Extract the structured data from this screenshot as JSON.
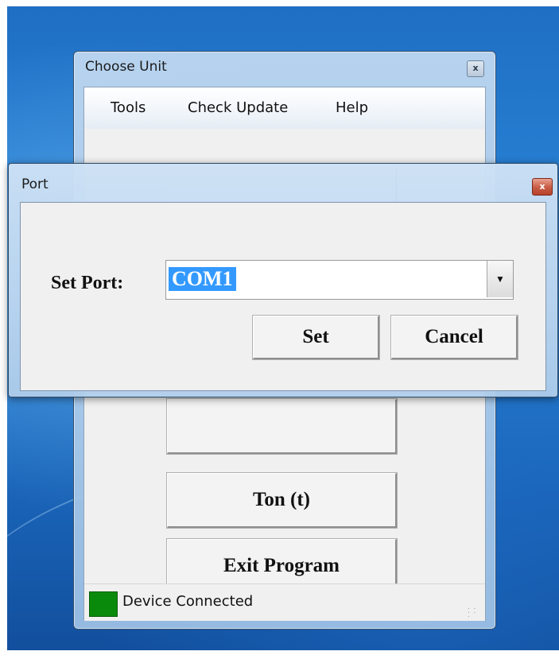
{
  "main_window": {
    "title": "Choose Unit",
    "close_glyph": "x",
    "menu": [
      "Tools",
      "Check Update",
      "Help"
    ],
    "buttons": [
      "Ton (t)",
      "Exit Program"
    ],
    "status": {
      "text": "Device Connected",
      "led_color": "#0a8a0a"
    }
  },
  "port_dialog": {
    "title": "Port",
    "close_glyph": "x",
    "label": "Set Port:",
    "combo_value": "COM1",
    "set_button": "Set",
    "cancel_button": "Cancel"
  },
  "colors": {
    "selection": "#3399ff",
    "close_button": "#c75a43"
  },
  "icons": [
    "close-icon",
    "dropdown-arrow-icon",
    "resize-grip-icon"
  ]
}
